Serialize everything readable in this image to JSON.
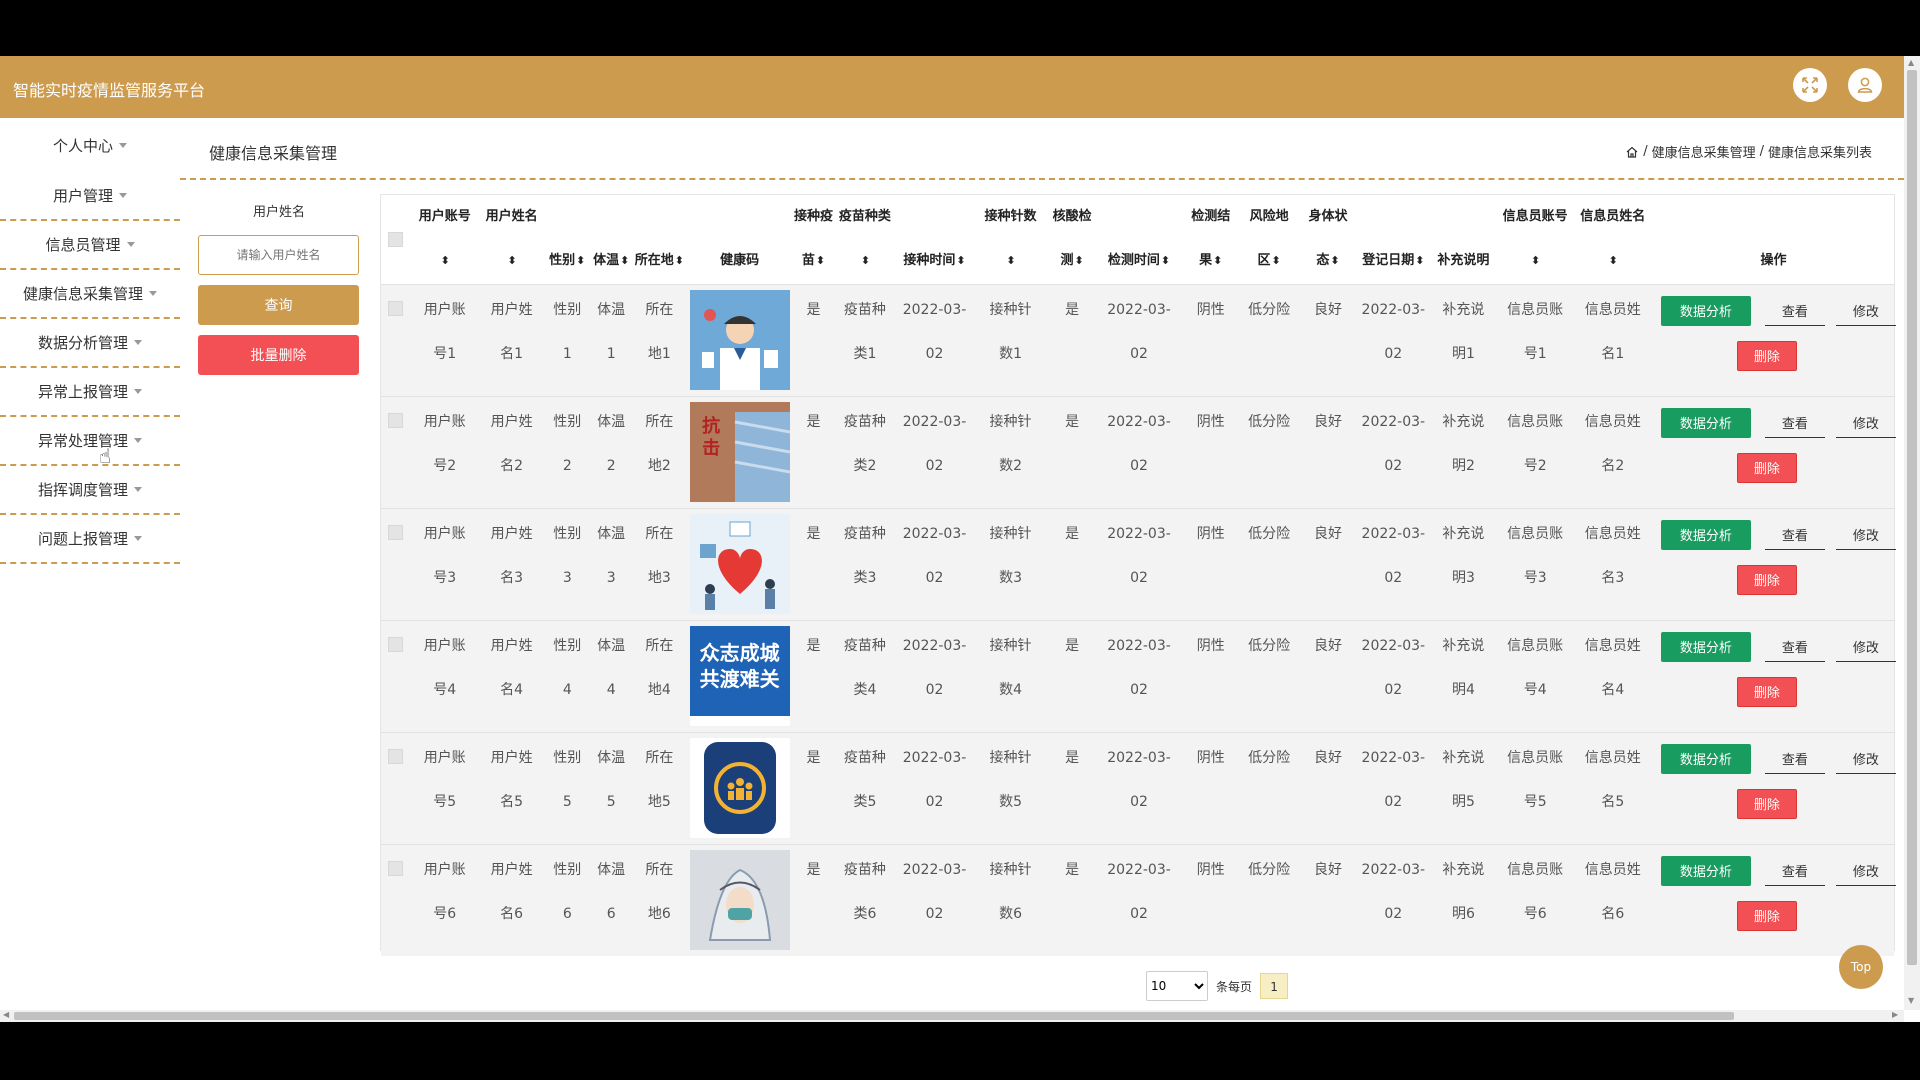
{
  "app": {
    "title": "智能实时疫情监管服务平台"
  },
  "header": {
    "fullscreen_icon": "fullscreen-icon",
    "user_icon": "user-icon"
  },
  "sidebar": {
    "items": [
      {
        "label": "个人中心"
      },
      {
        "label": "用户管理"
      },
      {
        "label": "信息员管理"
      },
      {
        "label": "健康信息采集管理"
      },
      {
        "label": "数据分析管理"
      },
      {
        "label": "异常上报管理"
      },
      {
        "label": "异常处理管理"
      },
      {
        "label": "指挥调度管理"
      },
      {
        "label": "问题上报管理"
      }
    ]
  },
  "page": {
    "title": "健康信息采集管理",
    "breadcrumb": {
      "sep": "/",
      "level1": "健康信息采集管理",
      "level2": "健康信息采集列表"
    }
  },
  "search": {
    "label": "用户姓名",
    "placeholder": "请输入用户姓名",
    "query_label": "查询",
    "batch_delete_label": "批量删除"
  },
  "table": {
    "columns": [
      {
        "l1": "用户账号",
        "l2": "",
        "sort": true
      },
      {
        "l1": "用户姓名",
        "l2": "",
        "sort": true
      },
      {
        "l1": "",
        "l2": "性别",
        "sort": true
      },
      {
        "l1": "",
        "l2": "体温",
        "sort": true
      },
      {
        "l1": "",
        "l2": "所在地",
        "sort": true
      },
      {
        "l1": "",
        "l2": "健康码",
        "sort": false
      },
      {
        "l1": "接种疫",
        "l2": "苗",
        "sort": true
      },
      {
        "l1": "疫苗种类",
        "l2": "",
        "sort": true
      },
      {
        "l1": "",
        "l2": "接种时间",
        "sort": true
      },
      {
        "l1": "接种针数",
        "l2": "",
        "sort": true
      },
      {
        "l1": "核酸检",
        "l2": "测",
        "sort": true
      },
      {
        "l1": "",
        "l2": "检测时间",
        "sort": true
      },
      {
        "l1": "检测结",
        "l2": "果",
        "sort": true
      },
      {
        "l1": "风险地",
        "l2": "区",
        "sort": true
      },
      {
        "l1": "身体状",
        "l2": "态",
        "sort": true
      },
      {
        "l1": "",
        "l2": "登记日期",
        "sort": true
      },
      {
        "l1": "",
        "l2": "补充说明",
        "sort": false
      },
      {
        "l1": "信息员账号",
        "l2": "",
        "sort": true
      },
      {
        "l1": "信息员姓名",
        "l2": "",
        "sort": true
      },
      {
        "l1": "",
        "l2": "操作",
        "sort": false
      }
    ],
    "rows": [
      {
        "cells": [
          [
            "用户账",
            "号1"
          ],
          [
            "用户姓",
            "名1"
          ],
          [
            "性别",
            "1"
          ],
          [
            "体温",
            "1"
          ],
          [
            "所在",
            "地1"
          ],
          [
            "是",
            ""
          ],
          [
            "疫苗种",
            "类1"
          ],
          [
            "2022-03-",
            "02"
          ],
          [
            "接种针",
            "数1"
          ],
          [
            "是",
            ""
          ],
          [
            "2022-03-",
            "02"
          ],
          [
            "阴性",
            ""
          ],
          [
            "低分险",
            ""
          ],
          [
            "良好",
            ""
          ],
          [
            "2022-03-",
            "02"
          ],
          [
            "补充说",
            "明1"
          ],
          [
            "信息员账",
            "号1"
          ],
          [
            "信息员姓",
            "名1"
          ]
        ]
      },
      {
        "cells": [
          [
            "用户账",
            "号2"
          ],
          [
            "用户姓",
            "名2"
          ],
          [
            "性别",
            "2"
          ],
          [
            "体温",
            "2"
          ],
          [
            "所在",
            "地2"
          ],
          [
            "是",
            ""
          ],
          [
            "疫苗种",
            "类2"
          ],
          [
            "2022-03-",
            "02"
          ],
          [
            "接种针",
            "数2"
          ],
          [
            "是",
            ""
          ],
          [
            "2022-03-",
            "02"
          ],
          [
            "阴性",
            ""
          ],
          [
            "低分险",
            ""
          ],
          [
            "良好",
            ""
          ],
          [
            "2022-03-",
            "02"
          ],
          [
            "补充说",
            "明2"
          ],
          [
            "信息员账",
            "号2"
          ],
          [
            "信息员姓",
            "名2"
          ]
        ]
      },
      {
        "cells": [
          [
            "用户账",
            "号3"
          ],
          [
            "用户姓",
            "名3"
          ],
          [
            "性别",
            "3"
          ],
          [
            "体温",
            "3"
          ],
          [
            "所在",
            "地3"
          ],
          [
            "是",
            ""
          ],
          [
            "疫苗种",
            "类3"
          ],
          [
            "2022-03-",
            "02"
          ],
          [
            "接种针",
            "数3"
          ],
          [
            "是",
            ""
          ],
          [
            "2022-03-",
            "02"
          ],
          [
            "阴性",
            ""
          ],
          [
            "低分险",
            ""
          ],
          [
            "良好",
            ""
          ],
          [
            "2022-03-",
            "02"
          ],
          [
            "补充说",
            "明3"
          ],
          [
            "信息员账",
            "号3"
          ],
          [
            "信息员姓",
            "名3"
          ]
        ]
      },
      {
        "cells": [
          [
            "用户账",
            "号4"
          ],
          [
            "用户姓",
            "名4"
          ],
          [
            "性别",
            "4"
          ],
          [
            "体温",
            "4"
          ],
          [
            "所在",
            "地4"
          ],
          [
            "是",
            ""
          ],
          [
            "疫苗种",
            "类4"
          ],
          [
            "2022-03-",
            "02"
          ],
          [
            "接种针",
            "数4"
          ],
          [
            "是",
            ""
          ],
          [
            "2022-03-",
            "02"
          ],
          [
            "阴性",
            ""
          ],
          [
            "低分险",
            ""
          ],
          [
            "良好",
            ""
          ],
          [
            "2022-03-",
            "02"
          ],
          [
            "补充说",
            "明4"
          ],
          [
            "信息员账",
            "号4"
          ],
          [
            "信息员姓",
            "名4"
          ]
        ]
      },
      {
        "cells": [
          [
            "用户账",
            "号5"
          ],
          [
            "用户姓",
            "名5"
          ],
          [
            "性别",
            "5"
          ],
          [
            "体温",
            "5"
          ],
          [
            "所在",
            "地5"
          ],
          [
            "是",
            ""
          ],
          [
            "疫苗种",
            "类5"
          ],
          [
            "2022-03-",
            "02"
          ],
          [
            "接种针",
            "数5"
          ],
          [
            "是",
            ""
          ],
          [
            "2022-03-",
            "02"
          ],
          [
            "阴性",
            ""
          ],
          [
            "低分险",
            ""
          ],
          [
            "良好",
            ""
          ],
          [
            "2022-03-",
            "02"
          ],
          [
            "补充说",
            "明5"
          ],
          [
            "信息员账",
            "号5"
          ],
          [
            "信息员姓",
            "名5"
          ]
        ]
      },
      {
        "cells": [
          [
            "用户账",
            "号6"
          ],
          [
            "用户姓",
            "名6"
          ],
          [
            "性别",
            "6"
          ],
          [
            "体温",
            "6"
          ],
          [
            "所在",
            "地6"
          ],
          [
            "是",
            ""
          ],
          [
            "疫苗种",
            "类6"
          ],
          [
            "2022-03-",
            "02"
          ],
          [
            "接种针",
            "数6"
          ],
          [
            "是",
            ""
          ],
          [
            "2022-03-",
            "02"
          ],
          [
            "阴性",
            ""
          ],
          [
            "低分险",
            ""
          ],
          [
            "良好",
            ""
          ],
          [
            "2022-03-",
            "02"
          ],
          [
            "补充说",
            "明6"
          ],
          [
            "信息员账",
            "号6"
          ],
          [
            "信息员姓",
            "名6"
          ]
        ]
      }
    ],
    "images": [
      {
        "name": "health-code-image-doctor",
        "banner_text": ""
      },
      {
        "name": "health-code-image-mask",
        "banner_text": "抗击"
      },
      {
        "name": "health-code-image-heart",
        "banner_text": ""
      },
      {
        "name": "health-code-image-slogan",
        "banner_text": "众志成城\n共渡难关"
      },
      {
        "name": "health-code-image-badge",
        "banner_text": ""
      },
      {
        "name": "health-code-image-painting",
        "banner_text": ""
      }
    ],
    "actions": {
      "analyze": "数据分析",
      "view": "查看",
      "edit": "修改",
      "delete": "删除"
    }
  },
  "pagination": {
    "page_size": "10",
    "per_page_label": "条每页",
    "current_page": "1"
  },
  "back_to_top": "Top",
  "colors": {
    "brand": "#cc9b4e",
    "danger": "#f35055",
    "success": "#189c5f"
  }
}
